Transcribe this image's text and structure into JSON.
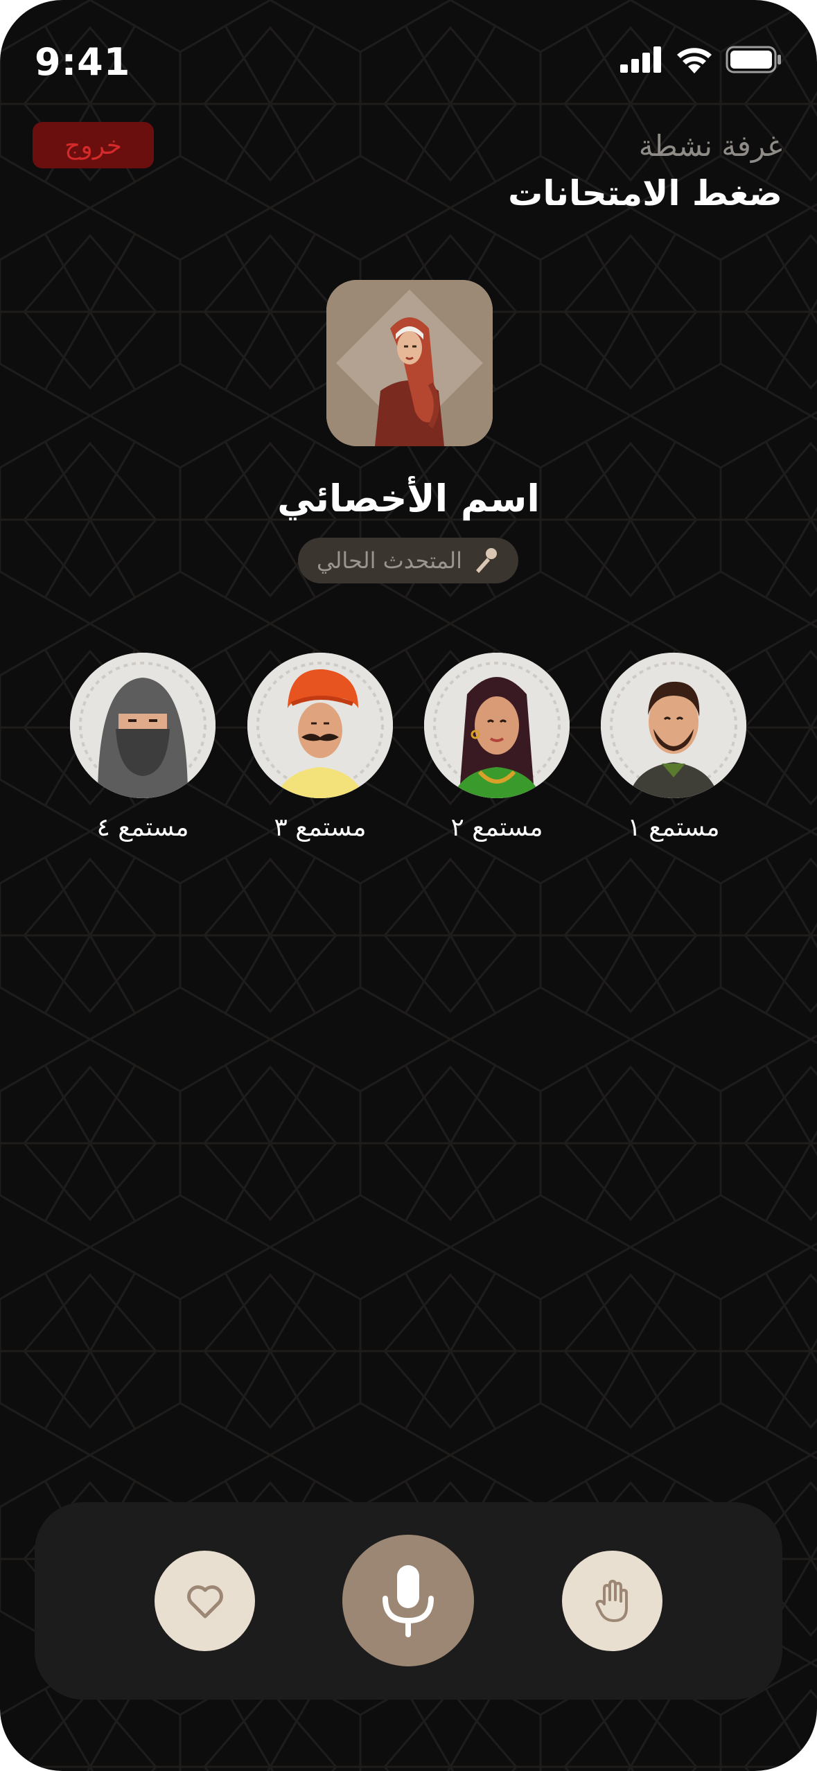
{
  "status_bar": {
    "time": "9:41"
  },
  "header": {
    "exit_label": "خروج",
    "room_label": "غرفة نشطة",
    "room_title": "ضغط الامتحانات"
  },
  "host": {
    "name": "اسم الأخصائي",
    "badge_label": "المتحدث الحالي",
    "badge_icon": "microphone-icon"
  },
  "listeners": [
    {
      "name": "مستمع ١",
      "avatar": "bearded-man-avatar"
    },
    {
      "name": "مستمع ٢",
      "avatar": "woman-avatar"
    },
    {
      "name": "مستمع ٣",
      "avatar": "turban-man-avatar"
    },
    {
      "name": "مستمع ٤",
      "avatar": "veiled-woman-avatar"
    }
  ],
  "controls": {
    "heart_icon": "heart-icon",
    "mic_icon": "microphone-icon",
    "hand_icon": "raise-hand-icon"
  },
  "colors": {
    "background": "#0e0d0d",
    "exit_bg": "#6b0e0e",
    "exit_text": "#d42a2a",
    "accent": "#9b8773",
    "control_light": "#e9dfd1"
  }
}
